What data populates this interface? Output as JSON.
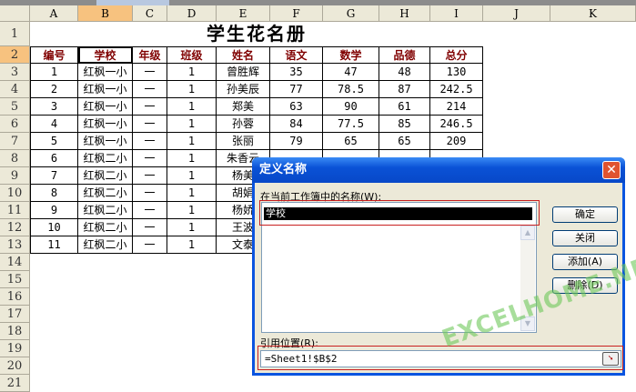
{
  "columns": [
    "A",
    "B",
    "C",
    "D",
    "E",
    "F",
    "G",
    "H",
    "I",
    "J",
    "K"
  ],
  "rows": [
    "1",
    "2",
    "3",
    "4",
    "5",
    "6",
    "7",
    "8",
    "9",
    "10",
    "11",
    "12",
    "13",
    "14",
    "15",
    "16",
    "17",
    "18",
    "19",
    "20",
    "21"
  ],
  "sheet_title": "学生花名册",
  "headers": [
    "编号",
    "学校",
    "年级",
    "班级",
    "姓名",
    "语文",
    "数学",
    "品德",
    "总分"
  ],
  "data": [
    [
      "1",
      "红枫一小",
      "一",
      "1",
      "曾胜辉",
      "35",
      "47",
      "48",
      "130"
    ],
    [
      "2",
      "红枫一小",
      "一",
      "1",
      "孙美辰",
      "77",
      "78.5",
      "87",
      "242.5"
    ],
    [
      "3",
      "红枫一小",
      "一",
      "1",
      "郑美",
      "63",
      "90",
      "61",
      "214"
    ],
    [
      "4",
      "红枫一小",
      "一",
      "1",
      "孙蓉",
      "84",
      "77.5",
      "85",
      "246.5"
    ],
    [
      "5",
      "红枫一小",
      "一",
      "1",
      "张丽",
      "79",
      "65",
      "65",
      "209"
    ],
    [
      "6",
      "红枫二小",
      "一",
      "1",
      "朱香云",
      "",
      "",
      "",
      ""
    ],
    [
      "7",
      "红枫二小",
      "一",
      "1",
      "杨美",
      "",
      "",
      "",
      ""
    ],
    [
      "8",
      "红枫二小",
      "一",
      "1",
      "胡娟",
      "",
      "",
      "",
      ""
    ],
    [
      "9",
      "红枫二小",
      "一",
      "1",
      "杨娇",
      "",
      "",
      "",
      ""
    ],
    [
      "10",
      "红枫二小",
      "一",
      "1",
      "王波",
      "",
      "",
      "",
      ""
    ],
    [
      "11",
      "红枫二小",
      "一",
      "1",
      "文泰",
      "",
      "",
      "",
      ""
    ]
  ],
  "dialog": {
    "title": "定义名称",
    "close": "✕",
    "names_label": "在当前工作簿中的名称(W):",
    "name_value": "学校",
    "ok": "确定",
    "close_btn": "关闭",
    "add": "添加(A)",
    "delete": "删除(D)",
    "ref_label": "引用位置(R):",
    "ref_value": "=Sheet1!$B$2"
  },
  "watermark": "EXCELHOME.NET"
}
